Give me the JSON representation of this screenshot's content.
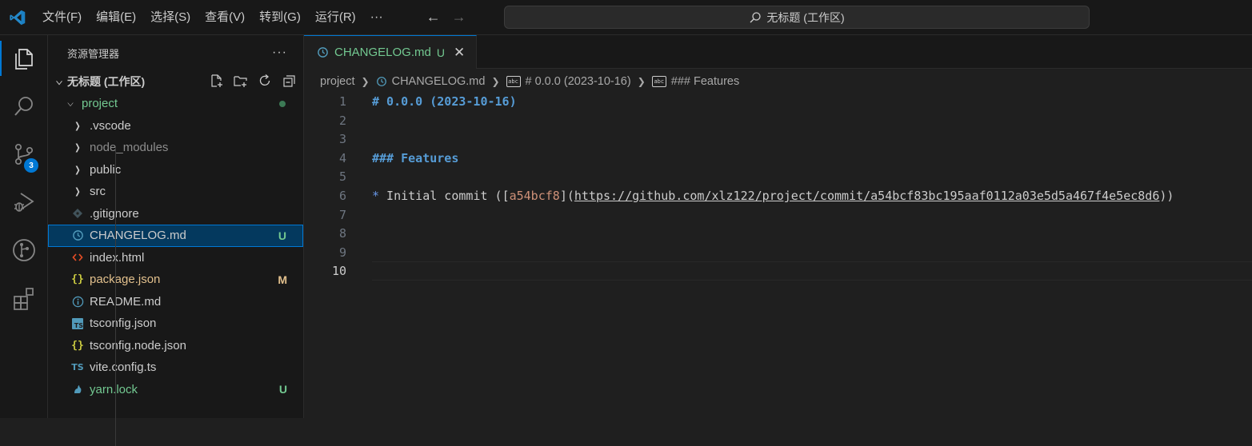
{
  "titlebar": {
    "menu": [
      "文件(F)",
      "编辑(E)",
      "选择(S)",
      "查看(V)",
      "转到(G)",
      "运行(R)"
    ],
    "more": "···",
    "back_icon": "arrow-left-icon",
    "forward_icon": "arrow-right-icon",
    "command_center": "无标题 (工作区)"
  },
  "activity_bar": {
    "items": [
      "explorer-icon",
      "search-icon",
      "source-control-icon",
      "run-debug-icon",
      "remote-explorer-icon",
      "extensions-icon"
    ],
    "scm_badge": "3",
    "accent": "#0078d4"
  },
  "sidebar": {
    "title": "资源管理器",
    "more": "···",
    "workspace": "无标题 (工作区)",
    "folder": "project",
    "tree": [
      {
        "label": ".vscode",
        "kind": "folder",
        "color": "#cccccc"
      },
      {
        "label": "node_modules",
        "kind": "folder",
        "color": "#8c8c8c"
      },
      {
        "label": "public",
        "kind": "folder",
        "color": "#cccccc"
      },
      {
        "label": "src",
        "kind": "folder",
        "color": "#cccccc"
      },
      {
        "label": ".gitignore",
        "kind": "file",
        "icon": "git-diamond-icon",
        "color": "#cccccc"
      },
      {
        "label": "CHANGELOG.md",
        "kind": "file",
        "icon": "clock-icon",
        "color": "#cccccc",
        "status": "U",
        "selected": true
      },
      {
        "label": "index.html",
        "kind": "file",
        "icon": "code-brackets-icon",
        "color": "#cccccc"
      },
      {
        "label": "package.json",
        "kind": "file",
        "icon": "json-braces-icon",
        "color": "#e2c08d",
        "status": "M"
      },
      {
        "label": "README.md",
        "kind": "file",
        "icon": "info-icon",
        "color": "#cccccc"
      },
      {
        "label": "tsconfig.json",
        "kind": "file",
        "icon": "ts-box-icon",
        "color": "#cccccc"
      },
      {
        "label": "tsconfig.node.json",
        "kind": "file",
        "icon": "json-braces-icon",
        "color": "#cccccc"
      },
      {
        "label": "vite.config.ts",
        "kind": "file",
        "icon": "ts-text-icon",
        "color": "#cccccc"
      },
      {
        "label": "yarn.lock",
        "kind": "file",
        "icon": "yarn-cat-icon",
        "color": "#73c991",
        "status": "U"
      }
    ],
    "status_colors": {
      "U": "#73c991",
      "M": "#e2c08d"
    }
  },
  "editor": {
    "tab": {
      "label": "CHANGELOG.md",
      "status": "U",
      "close": "✕"
    },
    "breadcrumbs": {
      "folder": "project",
      "file": "CHANGELOG.md",
      "heading1": "# 0.0.0 (2023-10-16)",
      "heading2": "### Features",
      "symbol_icon": "abc"
    },
    "lines": [
      {
        "n": "1",
        "heading": "# 0.0.0 (2023-10-16)"
      },
      {
        "n": "2"
      },
      {
        "n": "3"
      },
      {
        "n": "4",
        "heading": "### Features"
      },
      {
        "n": "5"
      },
      {
        "n": "6",
        "bullet": "*",
        "text": " Initial commit (",
        "open": "[",
        "link_text": "a54bcf8",
        "mid": "](",
        "url": "https://github.com/xlz122/project/commit/a54bcf83bc195aaf0112a03e5d5a467f4e5ec8d6",
        "close": "))"
      },
      {
        "n": "7"
      },
      {
        "n": "8"
      },
      {
        "n": "9"
      },
      {
        "n": "10",
        "current": true
      }
    ]
  }
}
